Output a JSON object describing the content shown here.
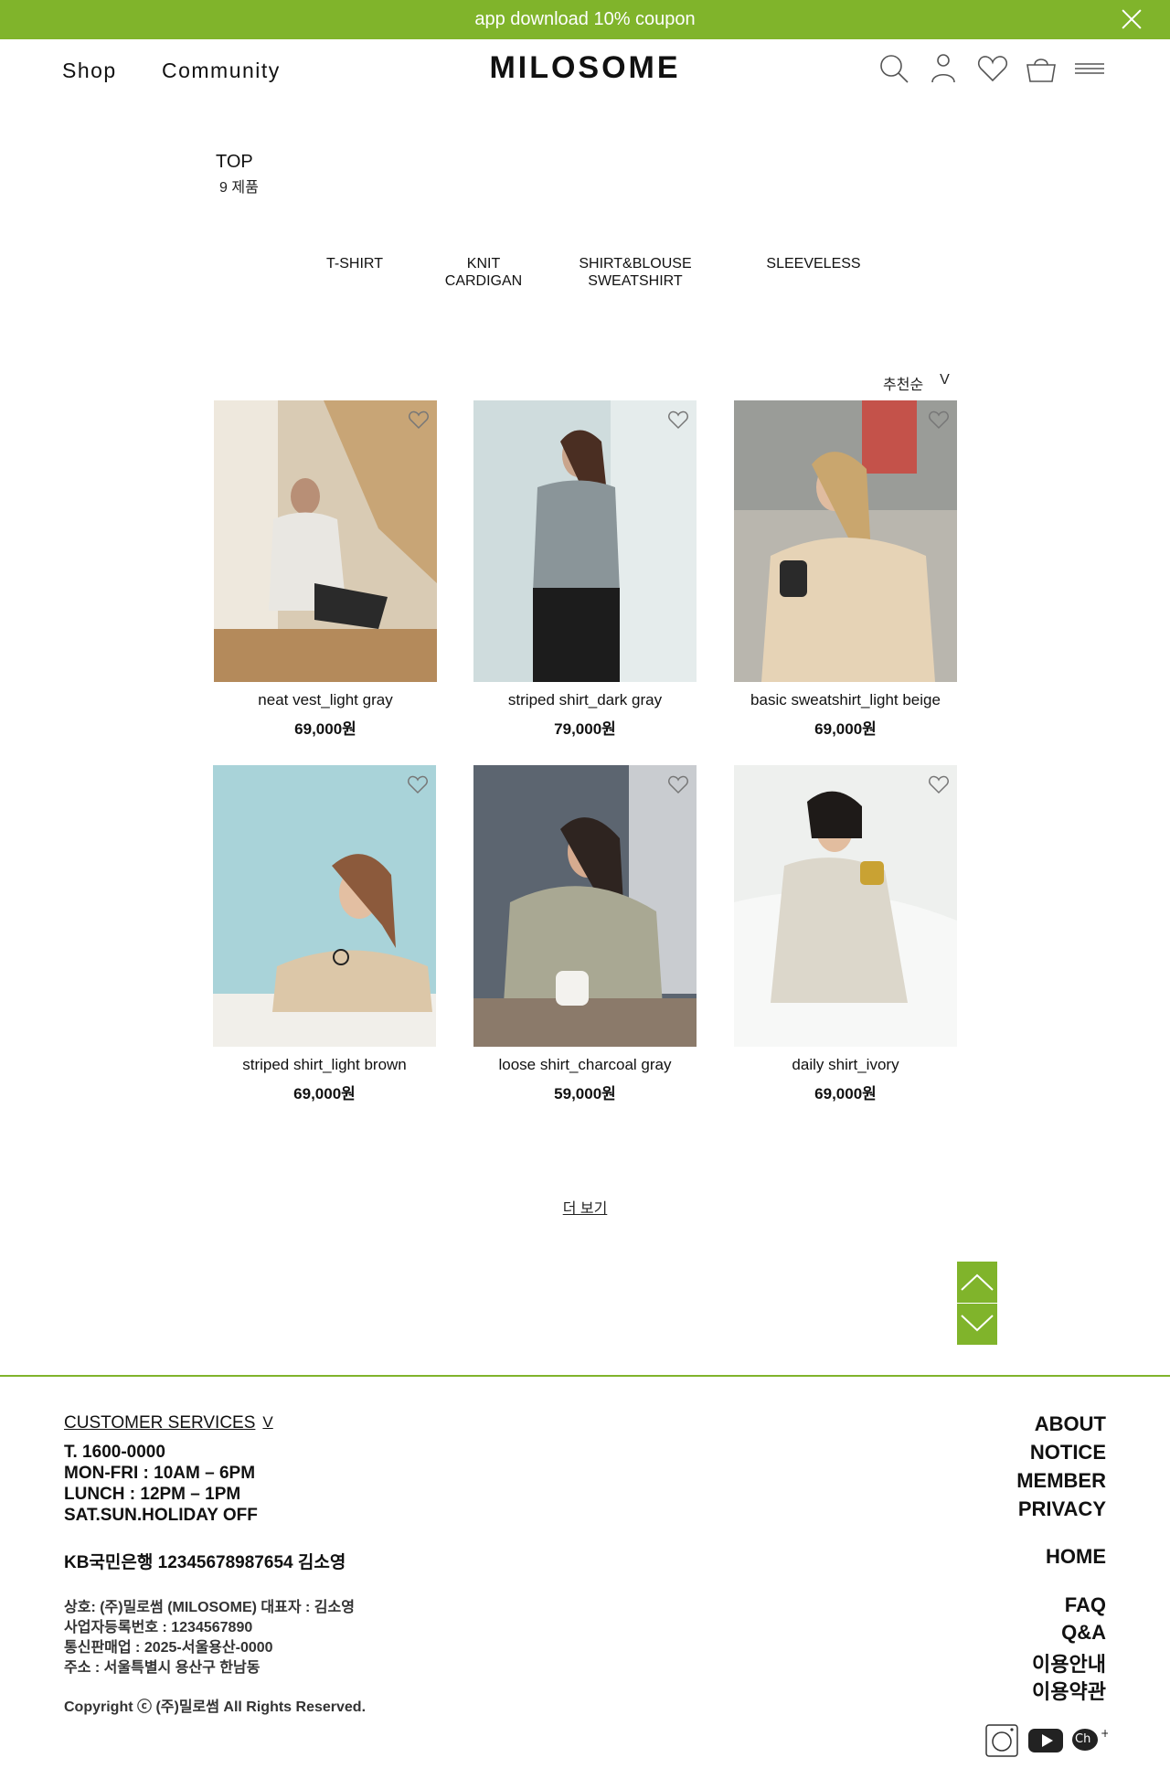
{
  "banner": {
    "text": "app download 10% coupon"
  },
  "nav": {
    "shop": "Shop",
    "community": "Community"
  },
  "logo": "MILOSOME",
  "category": {
    "title": "TOP",
    "count": "9 제품"
  },
  "subcategories": [
    {
      "line1": "T-SHIRT",
      "line2": ""
    },
    {
      "line1": "KNIT",
      "line2": "CARDIGAN"
    },
    {
      "line1": "SHIRT&BLOUSE",
      "line2": "SWEATSHIRT"
    },
    {
      "line1": "SLEEVELESS",
      "line2": ""
    }
  ],
  "sort": {
    "label": "추천순",
    "arrow": "V"
  },
  "products": [
    {
      "name": "neat vest_light gray",
      "price": "69,000원"
    },
    {
      "name": "striped shirt_dark gray",
      "price": "79,000원"
    },
    {
      "name": "basic sweatshirt_light beige",
      "price": "69,000원"
    },
    {
      "name": "striped shirt_light brown",
      "price": "69,000원"
    },
    {
      "name": "loose shirt_charcoal gray",
      "price": "59,000원"
    },
    {
      "name": "daily shirt_ivory",
      "price": "69,000원"
    }
  ],
  "more": "더 보기",
  "footer": {
    "cs_title": "CUSTOMER SERVICES",
    "cs_chevron": "V",
    "phone": "T. 1600-0000",
    "hours": "MON-FRI : 10AM – 6PM",
    "lunch": "LUNCH : 12PM – 1PM",
    "off": "SAT.SUN.HOLIDAY OFF",
    "bank": "KB국민은행 12345678987654 김소영",
    "company": "상호: (주)밀로썸 (MILOSOME)  대표자 : 김소영",
    "biz_no": "사업자등록번호 : 1234567890",
    "mail_order": "통신판매업 : 2025-서울용산-0000",
    "address": "주소 : 서울특별시 용산구 한남동",
    "copyright": "Copyright ⓒ (주)밀로썸 All Rights Reserved.",
    "links1": [
      "ABOUT",
      "NOTICE",
      "MEMBER",
      "PRIVACY"
    ],
    "home": "HOME",
    "links2": [
      "FAQ",
      "Q&A",
      "이용안내",
      "이용약관"
    ],
    "kakao": "Ch"
  },
  "colors": {
    "accent": "#80b42b"
  }
}
